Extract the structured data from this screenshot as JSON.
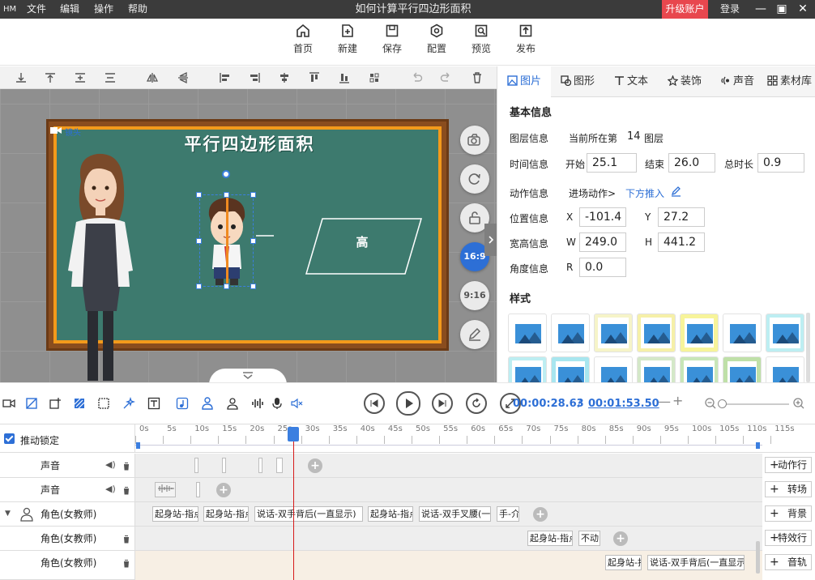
{
  "titlebar": {
    "logo": "HM",
    "menus": [
      "文件",
      "编辑",
      "操作",
      "帮助"
    ],
    "title": "如何计算平行四边形面积",
    "upgrade": "升级账户",
    "login": "登录"
  },
  "toolbar": {
    "items": [
      {
        "label": "首页",
        "icon": "home-icon"
      },
      {
        "label": "新建",
        "icon": "new-icon"
      },
      {
        "label": "保存",
        "icon": "save-icon"
      },
      {
        "label": "配置",
        "icon": "config-icon"
      },
      {
        "label": "预览",
        "icon": "preview-icon"
      },
      {
        "label": "发布",
        "icon": "publish-icon"
      }
    ]
  },
  "canvas": {
    "board_title": "平行四边形面积",
    "parallelogram_label": "高",
    "camera_label": "镜头",
    "ratio_16_9": "16:9",
    "ratio_9_16": "9:16"
  },
  "panel": {
    "tabs": [
      {
        "label": "图片",
        "icon": "image-icon"
      },
      {
        "label": "图形",
        "icon": "shape-icon"
      },
      {
        "label": "文本",
        "icon": "text-icon"
      },
      {
        "label": "装饰",
        "icon": "decor-icon"
      },
      {
        "label": "声音",
        "icon": "sound-icon"
      },
      {
        "label": "素材库",
        "icon": "library-icon"
      }
    ],
    "basic_info": "基本信息",
    "layer_label": "图层信息",
    "layer_prefix": "当前所在第",
    "layer_num": "14",
    "layer_suffix": "图层",
    "time_label": "时间信息",
    "start_label": "开始",
    "start": "25.1",
    "end_label": "结束",
    "end": "26.0",
    "duration_label": "总时长",
    "duration": "0.9",
    "anim_label": "动作信息",
    "anim_prefix": "进场动作>",
    "anim_value": "下方推入",
    "pos_label": "位置信息",
    "x_label": "X",
    "x": "-101.4",
    "y_label": "Y",
    "y": "27.2",
    "size_label": "宽高信息",
    "w_label": "W",
    "w": "249.0",
    "h_label": "H",
    "h": "441.2",
    "angle_label": "角度信息",
    "r_label": "R",
    "r": "0.0",
    "style_label": "样式"
  },
  "timeline": {
    "current": "00:00:28.63",
    "sep": "/",
    "total": "00:01:53.50",
    "lock_label": "推动锁定",
    "ticks": [
      "0s",
      "5s",
      "10s",
      "15s",
      "20s",
      "25s",
      "30s",
      "35s",
      "40s",
      "45s",
      "50s",
      "55s",
      "60s",
      "65s",
      "70s",
      "75s",
      "80s",
      "85s",
      "90s",
      "95s",
      "100s",
      "105s",
      "110s",
      "115s"
    ],
    "tracks": [
      {
        "name": "声音"
      },
      {
        "name": "声音"
      },
      {
        "name": "角色(女教师)"
      },
      {
        "name": "角色(女教师)"
      },
      {
        "name": "角色(女教师)"
      }
    ],
    "clips_row3": [
      "起身站-指点",
      "起身站-指点",
      "说话-双手背后(一直显示)",
      "起身站-指点",
      "说话-双手叉腰(一直)",
      "手-介"
    ],
    "clips_row4": [
      "起身站-指点",
      "不动"
    ],
    "clips_row5": [
      "起身站-指点",
      "说话-双手背后(一直显示)"
    ],
    "side_buttons": [
      "动作行",
      "转场",
      "背景",
      "特效行",
      "音轨"
    ]
  },
  "colors": {
    "accent": "#2d6fd6",
    "chalkboard": "#3d7a6e",
    "frame": "#f39a1b",
    "upgrade": "#e8474e",
    "playhead": "#d61a1a"
  }
}
